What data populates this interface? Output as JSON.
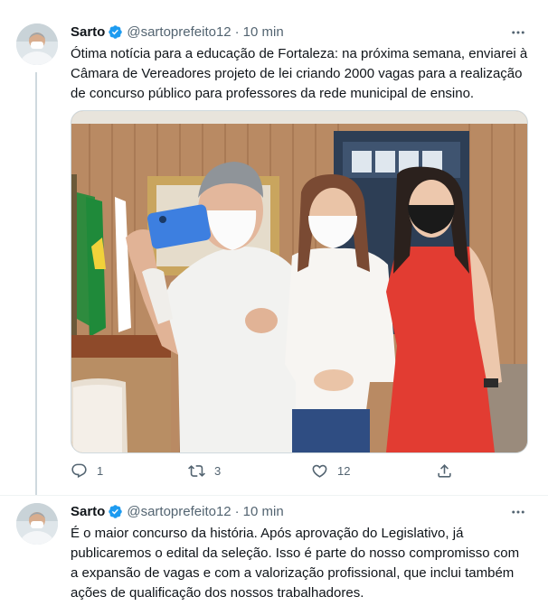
{
  "tweets": [
    {
      "name": "Sarto",
      "handle": "@sartoprefeito12",
      "separator": "·",
      "time": "10 min",
      "text": "Ótima notícia para a educação de Fortaleza: na próxima semana, enviarei à Câmara de Vereadores projeto de lei criando 2000 vagas para a realização de concurso público para professores da rede municipal de ensino.",
      "text_lines": [
        "Ótima notícia para a educação de Fortaleza: na próxima semana, enviarei à",
        "Câmara de Vereadores projeto de lei criando 2000 vagas para a realização",
        "de concurso público para professores da rede municipal de ensino."
      ],
      "actions": {
        "reply_count": "1",
        "retweet_count": "3",
        "like_count": "12"
      }
    },
    {
      "name": "Sarto",
      "handle": "@sartoprefeito12",
      "separator": "·",
      "time": "10 min",
      "text_lines": [
        "É o maior concurso da história. Após aprovação do Legislativo, já",
        "publicaremos o edital da seleção. Isso é parte do nosso compromisso com",
        "a expansão de vagas e com a valorização profissional, que inclui também",
        "ações de qualificação dos nossos trabalhadores."
      ]
    }
  ],
  "icons": {
    "verified": "verified-badge-icon",
    "more": "more-options-icon",
    "reply": "reply-icon",
    "retweet": "retweet-icon",
    "like": "heart-icon",
    "share": "share-icon"
  },
  "colors": {
    "verified": "#1d9bf0",
    "secondary_text": "#536471",
    "primary_text": "#0f1419",
    "thread_line": "#cfd9de"
  }
}
